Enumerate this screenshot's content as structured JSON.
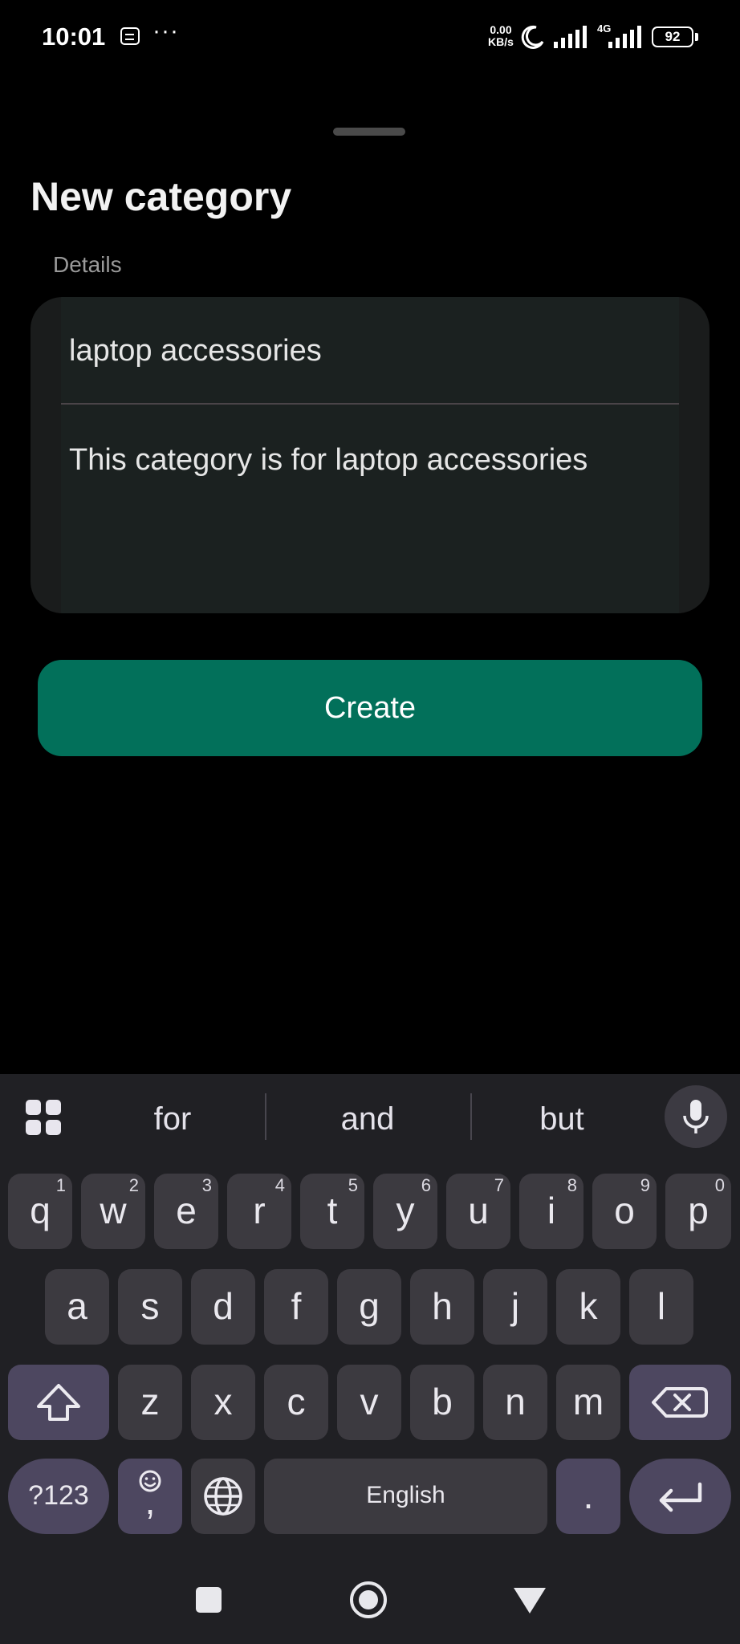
{
  "status_bar": {
    "time": "10:01",
    "more": "···",
    "net_speed_value": "0.00",
    "net_speed_unit": "KB/s",
    "network_type": "4G",
    "battery": "92"
  },
  "sheet": {
    "title": "New category",
    "section_label": "Details",
    "name_value": "laptop accessories",
    "description_value": "This category is for laptop accessories",
    "create_label": "Create"
  },
  "keyboard": {
    "suggestions": [
      "for",
      "and",
      "but"
    ],
    "row1": [
      {
        "k": "q",
        "n": "1"
      },
      {
        "k": "w",
        "n": "2"
      },
      {
        "k": "e",
        "n": "3"
      },
      {
        "k": "r",
        "n": "4"
      },
      {
        "k": "t",
        "n": "5"
      },
      {
        "k": "y",
        "n": "6"
      },
      {
        "k": "u",
        "n": "7"
      },
      {
        "k": "i",
        "n": "8"
      },
      {
        "k": "o",
        "n": "9"
      },
      {
        "k": "p",
        "n": "0"
      }
    ],
    "row2": [
      "a",
      "s",
      "d",
      "f",
      "g",
      "h",
      "j",
      "k",
      "l"
    ],
    "row3": [
      "z",
      "x",
      "c",
      "v",
      "b",
      "n",
      "m"
    ],
    "symbols_label": "?123",
    "emoji_comma": ",",
    "space_label": "English",
    "period_label": "."
  },
  "icons": {
    "message": "message-icon",
    "moon": "moon-icon",
    "signal": "signal-icon",
    "battery": "battery-icon",
    "apps": "apps-grid-icon",
    "mic": "mic-icon",
    "shift": "shift-icon",
    "backspace": "backspace-icon",
    "emoji": "emoji-icon",
    "globe": "globe-icon",
    "enter": "enter-icon",
    "nav_recents": "square-icon",
    "nav_home": "circle-icon",
    "nav_back": "triangle-icon"
  },
  "colors": {
    "accent": "#02705a",
    "background": "#000000",
    "keyboard_bg": "#202024"
  }
}
